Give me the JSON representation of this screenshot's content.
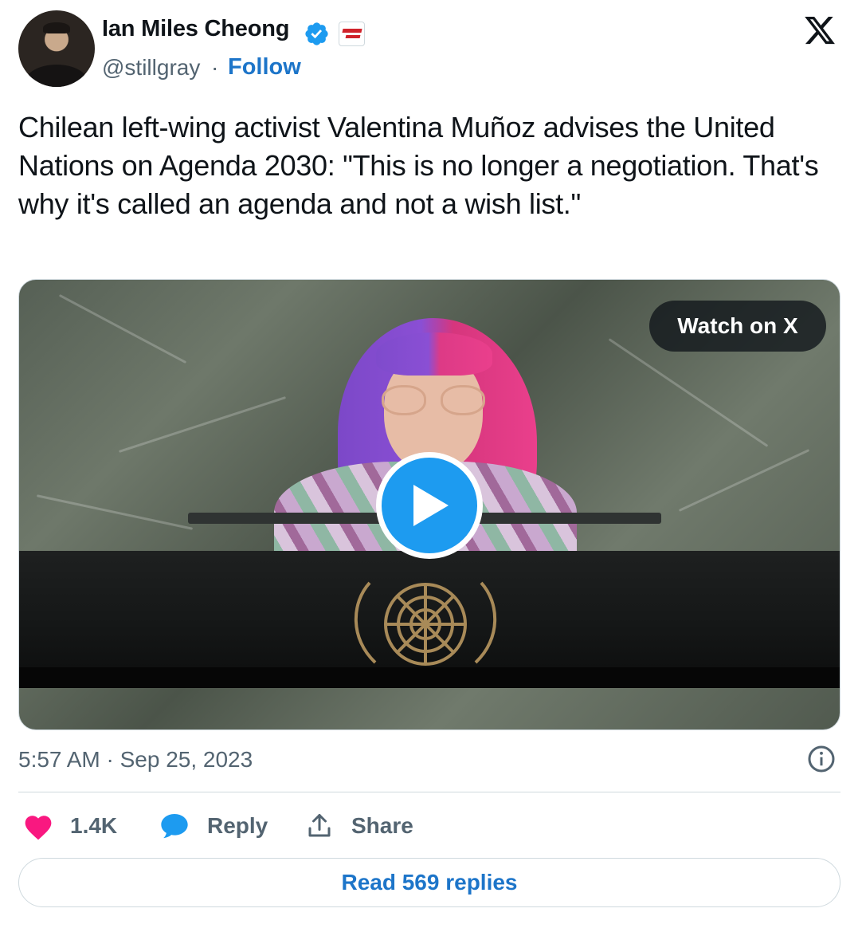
{
  "author": {
    "name": "Ian Miles Cheong",
    "handle": "@stillgray",
    "separator": "·",
    "follow_label": "Follow",
    "verified_color": "#1d9bf0",
    "affiliate_badge": "rebel-news-badge"
  },
  "tweet": {
    "text": "Chilean left-wing activist Valentina Muñoz advises the United Nations on Agenda 2030: \"This is no longer a negotiation. That's why it's called an agenda and not a wish list.\""
  },
  "media": {
    "watch_label": "Watch on X",
    "play_icon": "play-icon"
  },
  "meta": {
    "timestamp": "5:57 AM · Sep 25, 2023",
    "info_icon": "info-icon"
  },
  "actions": {
    "like_count": "1.4K",
    "reply_label": "Reply",
    "share_label": "Share",
    "like_color": "#f91880",
    "reply_color": "#1d9bf0"
  },
  "footer": {
    "read_replies_label": "Read 569 replies"
  },
  "brand": {
    "logo_icon": "x-logo-icon",
    "link_color": "#1d75c9"
  }
}
